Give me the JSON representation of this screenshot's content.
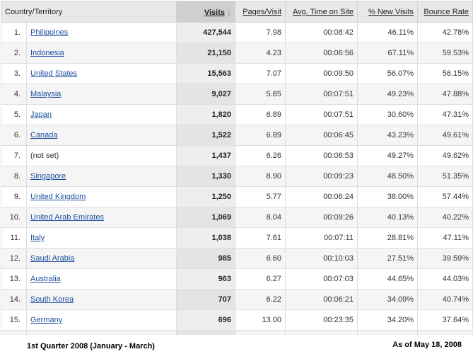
{
  "table": {
    "headers": {
      "country": "Country/Territory",
      "visits": "Visits",
      "pages_visit": "Pages/Visit",
      "avg_time": "Avg. Time on Site",
      "new_visits": "% New Visits",
      "bounce_rate": "Bounce Rate"
    },
    "sort_icon": "arrow-down-icon",
    "rows": [
      {
        "index": "1.",
        "country": "Philippines",
        "link": true,
        "visits": "427,544",
        "pages_visit": "7.98",
        "avg_time": "00:08:42",
        "new_visits": "46.11%",
        "bounce_rate": "42.78%"
      },
      {
        "index": "2.",
        "country": "Indonesia",
        "link": true,
        "visits": "21,150",
        "pages_visit": "4.23",
        "avg_time": "00:06:56",
        "new_visits": "67.11%",
        "bounce_rate": "59.53%"
      },
      {
        "index": "3.",
        "country": "United States",
        "link": true,
        "visits": "15,563",
        "pages_visit": "7.07",
        "avg_time": "00:09:50",
        "new_visits": "56.07%",
        "bounce_rate": "56.15%"
      },
      {
        "index": "4.",
        "country": "Malaysia",
        "link": true,
        "visits": "9,027",
        "pages_visit": "5.85",
        "avg_time": "00:07:51",
        "new_visits": "49.23%",
        "bounce_rate": "47.88%"
      },
      {
        "index": "5.",
        "country": "Japan",
        "link": true,
        "visits": "1,820",
        "pages_visit": "6.89",
        "avg_time": "00:07:51",
        "new_visits": "30.60%",
        "bounce_rate": "47.31%"
      },
      {
        "index": "6.",
        "country": "Canada",
        "link": true,
        "visits": "1,522",
        "pages_visit": "6.89",
        "avg_time": "00:06:45",
        "new_visits": "43.23%",
        "bounce_rate": "49.61%"
      },
      {
        "index": "7.",
        "country": "(not set)",
        "link": false,
        "visits": "1,437",
        "pages_visit": "6.26",
        "avg_time": "00:06:53",
        "new_visits": "49.27%",
        "bounce_rate": "49.62%"
      },
      {
        "index": "8.",
        "country": "Singapore",
        "link": true,
        "visits": "1,330",
        "pages_visit": "8.90",
        "avg_time": "00:09:23",
        "new_visits": "48.50%",
        "bounce_rate": "51.35%"
      },
      {
        "index": "9.",
        "country": "United Kingdom",
        "link": true,
        "visits": "1,250",
        "pages_visit": "5.77",
        "avg_time": "00:06:24",
        "new_visits": "38.00%",
        "bounce_rate": "57.44%"
      },
      {
        "index": "10.",
        "country": "United Arab Emirates",
        "link": true,
        "visits": "1,069",
        "pages_visit": "8.04",
        "avg_time": "00:09:26",
        "new_visits": "40.13%",
        "bounce_rate": "40.22%"
      },
      {
        "index": "11.",
        "country": "Italy",
        "link": true,
        "visits": "1,038",
        "pages_visit": "7.61",
        "avg_time": "00:07:11",
        "new_visits": "28.81%",
        "bounce_rate": "47.11%"
      },
      {
        "index": "12.",
        "country": "Saudi Arabia",
        "link": true,
        "visits": "985",
        "pages_visit": "6.60",
        "avg_time": "00:10:03",
        "new_visits": "27.51%",
        "bounce_rate": "39.59%"
      },
      {
        "index": "13.",
        "country": "Australia",
        "link": true,
        "visits": "963",
        "pages_visit": "6.27",
        "avg_time": "00:07:03",
        "new_visits": "44.65%",
        "bounce_rate": "44.03%"
      },
      {
        "index": "14.",
        "country": "South Korea",
        "link": true,
        "visits": "707",
        "pages_visit": "6.22",
        "avg_time": "00:06:21",
        "new_visits": "34.09%",
        "bounce_rate": "40.74%"
      },
      {
        "index": "15.",
        "country": "Germany",
        "link": true,
        "visits": "696",
        "pages_visit": "13.00",
        "avg_time": "00:23:35",
        "new_visits": "34.20%",
        "bounce_rate": "37.64%"
      }
    ]
  },
  "footer": {
    "period": "1st Quarter 2008 (January - March)",
    "as_of": "As of May 18, 2008"
  },
  "colors": {
    "link": "#1c4fa0",
    "header_bg": "#e8e8e8",
    "sorted_header_bg": "#cfcfcf"
  }
}
